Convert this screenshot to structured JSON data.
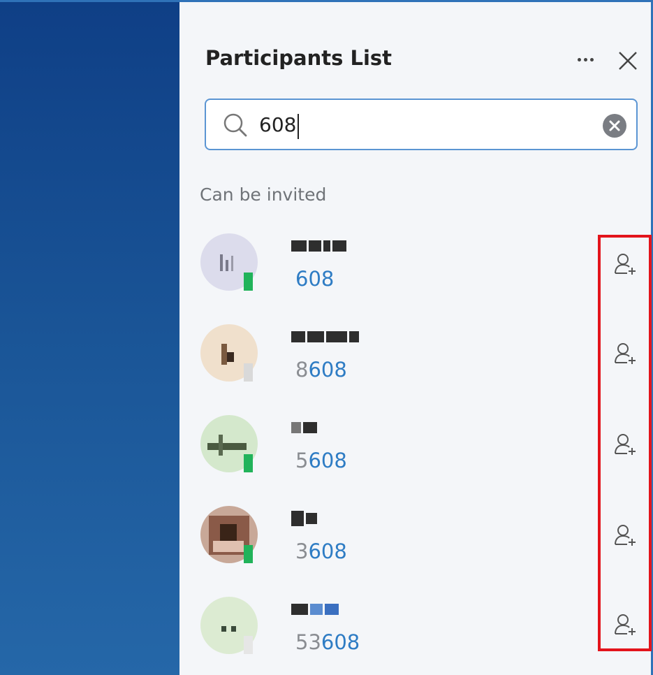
{
  "header": {
    "title": "Participants List"
  },
  "search": {
    "value": "608"
  },
  "section": {
    "label": "Can be invited"
  },
  "participants": [
    {
      "number_prefix": "",
      "number_match": "608",
      "status_color": "#21b35a"
    },
    {
      "number_prefix": "8",
      "number_match": "608",
      "status_color": "#d9d9d9"
    },
    {
      "number_prefix": "5",
      "number_match": "608",
      "status_color": "#21b35a"
    },
    {
      "number_prefix": "3",
      "number_match": "608",
      "status_color": "#21b35a"
    },
    {
      "number_prefix": "53",
      "number_match": "608",
      "status_color": "#e6e6e6"
    }
  ],
  "colors": {
    "accent": "#2e7cc4",
    "highlight": "#e3141c",
    "online": "#21b35a"
  },
  "icons": {
    "more": "more-options-icon",
    "close": "close-icon",
    "search": "search-icon",
    "clear": "clear-icon",
    "invite": "add-user-icon"
  }
}
